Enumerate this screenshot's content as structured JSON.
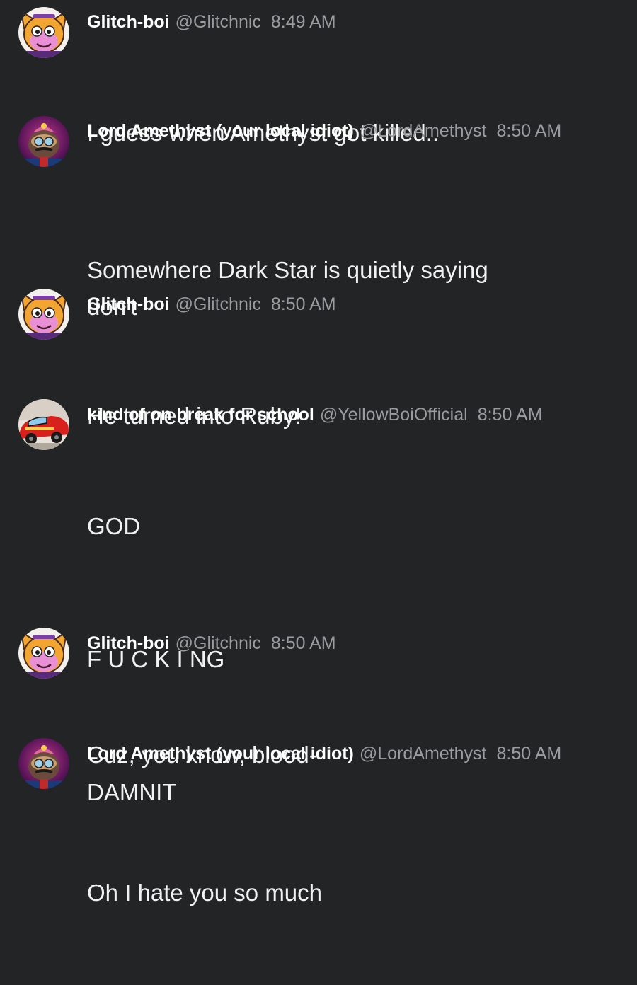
{
  "colors": {
    "background": "#232425",
    "author": "#ffffff",
    "meta": "#9a9d9f",
    "message": "#f2f2f2"
  },
  "messages": [
    {
      "avatar": "glitch-avatar",
      "author": "Glitch-boi",
      "handle": "@Glitchnic",
      "time": "8:49 AM",
      "lines": [
        "I guess when Amethyst got killed.."
      ]
    },
    {
      "avatar": "amethyst-avatar",
      "author": "Lord Amethyst (your local idiot)",
      "handle": "@LordAmethyst",
      "time": "8:50 AM",
      "lines": [
        "Somewhere Dark Star is quietly saying don't"
      ]
    },
    {
      "avatar": "glitch-avatar",
      "author": "Glitch-boi",
      "handle": "@Glitchnic",
      "time": "8:50 AM",
      "lines": [
        "He turned into Ruby!"
      ]
    },
    {
      "avatar": "race-car-avatar",
      "author": "kind of on break for school",
      "handle": "@YellowBoiOfficial",
      "time": "8:50 AM",
      "lines": [
        "GOD",
        "F U C K I NG",
        "DAMNIT"
      ]
    },
    {
      "avatar": "glitch-avatar",
      "author": "Glitch-boi",
      "handle": "@Glitchnic",
      "time": "8:50 AM",
      "lines": [
        "Cuz, you know, blood-"
      ]
    },
    {
      "avatar": "amethyst-avatar",
      "author": "Lord Amethyst (your local idiot)",
      "handle": "@LordAmethyst",
      "time": "8:50 AM",
      "lines": [
        "Oh I hate you so much"
      ]
    }
  ]
}
